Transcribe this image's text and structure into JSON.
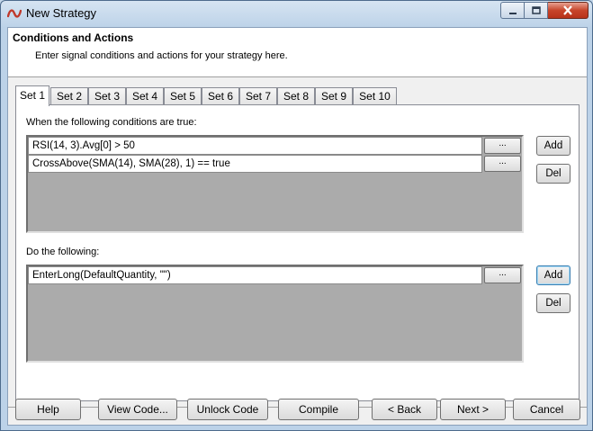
{
  "window": {
    "title": "New Strategy"
  },
  "header": {
    "title": "Conditions and Actions",
    "subtitle": "Enter signal conditions and actions for your strategy here."
  },
  "tabs": [
    {
      "label": "Set 1",
      "active": true
    },
    {
      "label": "Set 2",
      "active": false
    },
    {
      "label": "Set 3",
      "active": false
    },
    {
      "label": "Set 4",
      "active": false
    },
    {
      "label": "Set 5",
      "active": false
    },
    {
      "label": "Set 6",
      "active": false
    },
    {
      "label": "Set 7",
      "active": false
    },
    {
      "label": "Set 8",
      "active": false
    },
    {
      "label": "Set 9",
      "active": false
    },
    {
      "label": "Set 10",
      "active": false
    }
  ],
  "conditions": {
    "label": "When the following conditions are true:",
    "items": [
      {
        "text": "RSI(14, 3).Avg[0] > 50",
        "button": "..."
      },
      {
        "text": "CrossAbove(SMA(14), SMA(28), 1) == true",
        "button": "..."
      }
    ],
    "add_label": "Add",
    "del_label": "Del"
  },
  "actions": {
    "label": "Do the following:",
    "items": [
      {
        "text": "EnterLong(DefaultQuantity, \"\")",
        "button": "..."
      }
    ],
    "add_label": "Add",
    "del_label": "Del"
  },
  "footer": {
    "help": "Help",
    "view_code": "View Code...",
    "unlock_code": "Unlock Code",
    "compile": "Compile",
    "back": "< Back",
    "next": "Next >",
    "cancel": "Cancel"
  },
  "colors": {
    "list_background": "#ababab",
    "close_button": "#c7452b",
    "focus_border": "#3c7fb1"
  }
}
